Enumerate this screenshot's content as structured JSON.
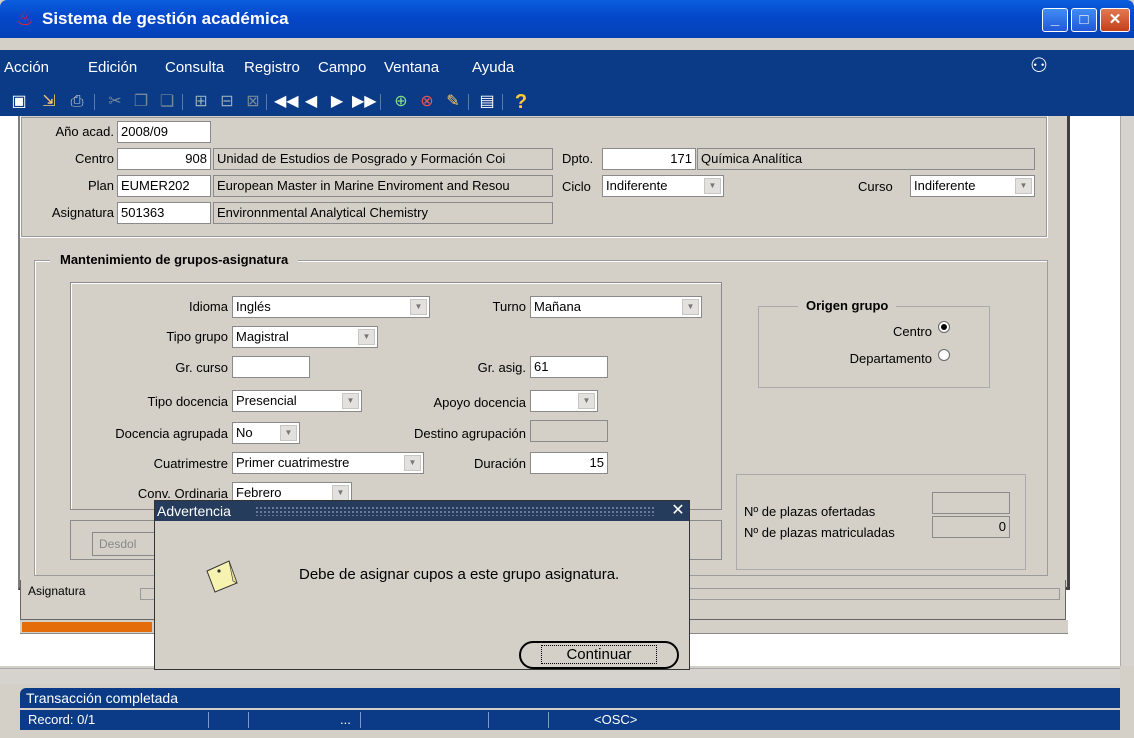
{
  "window": {
    "title": "Sistema de gestión académica"
  },
  "menu": [
    "Acción",
    "Edición",
    "Consulta",
    "Registro",
    "Campo",
    "Ventana",
    "Ayuda"
  ],
  "header": {
    "ano_label": "Año acad.",
    "ano_value": "2008/09",
    "centro_label": "Centro",
    "centro_code": "908",
    "centro_name": "Unidad de Estudios de Posgrado y Formación Coi",
    "dpto_label": "Dpto.",
    "dpto_code": "171",
    "dpto_name": "Química Analítica",
    "plan_label": "Plan",
    "plan_code": "EUMER202",
    "plan_name": "European Master in Marine Enviroment and Resou",
    "ciclo_label": "Ciclo",
    "ciclo_value": "Indiferente",
    "curso_label": "Curso",
    "curso_value": "Indiferente",
    "asig_label": "Asignatura",
    "asig_code": "501363",
    "asig_name": "Environnmental Analytical Chemistry"
  },
  "group": {
    "title": "Mantenimiento de grupos-asignatura",
    "idioma_label": "Idioma",
    "idioma_value": "Inglés",
    "turno_label": "Turno",
    "turno_value": "Mañana",
    "tipo_grupo_label": "Tipo grupo",
    "tipo_grupo_value": "Magistral",
    "gr_curso_label": "Gr. curso",
    "gr_curso_value": "",
    "gr_asig_label": "Gr. asig.",
    "gr_asig_value": "61",
    "tipo_docencia_label": "Tipo docencia",
    "tipo_docencia_value": "Presencial",
    "apoyo_label": "Apoyo docencia",
    "apoyo_value": "",
    "agrupada_label": "Docencia agrupada",
    "agrupada_value": "No",
    "destino_label": "Destino agrupación",
    "destino_value": "",
    "cuatri_label": "Cuatrimestre",
    "cuatri_value": "Primer cuatrimestre",
    "duracion_label": "Duración",
    "duracion_value": "15",
    "conv_label": "Conv. Ordinaria",
    "conv_value": "Febrero",
    "desdoblar_label": "Desdol",
    "origen_title": "Origen grupo",
    "origen_centro": "Centro",
    "origen_departamento": "Departamento",
    "plazas_ofertadas_label": "Nº de plazas ofertadas",
    "plazas_ofertadas_value": "",
    "plazas_matriculadas_label": "Nº de plazas matriculadas",
    "plazas_matriculadas_value": "0",
    "asignatura_tab": "Asignatura"
  },
  "dialog": {
    "title": "Advertencia",
    "message": "Debe de asignar cupos a este grupo asignatura.",
    "button": "Continuar"
  },
  "status": {
    "line1": "Transacción completada",
    "record": "Record: 0/1",
    "ellipsis": "...",
    "osc": "<OSC>"
  }
}
